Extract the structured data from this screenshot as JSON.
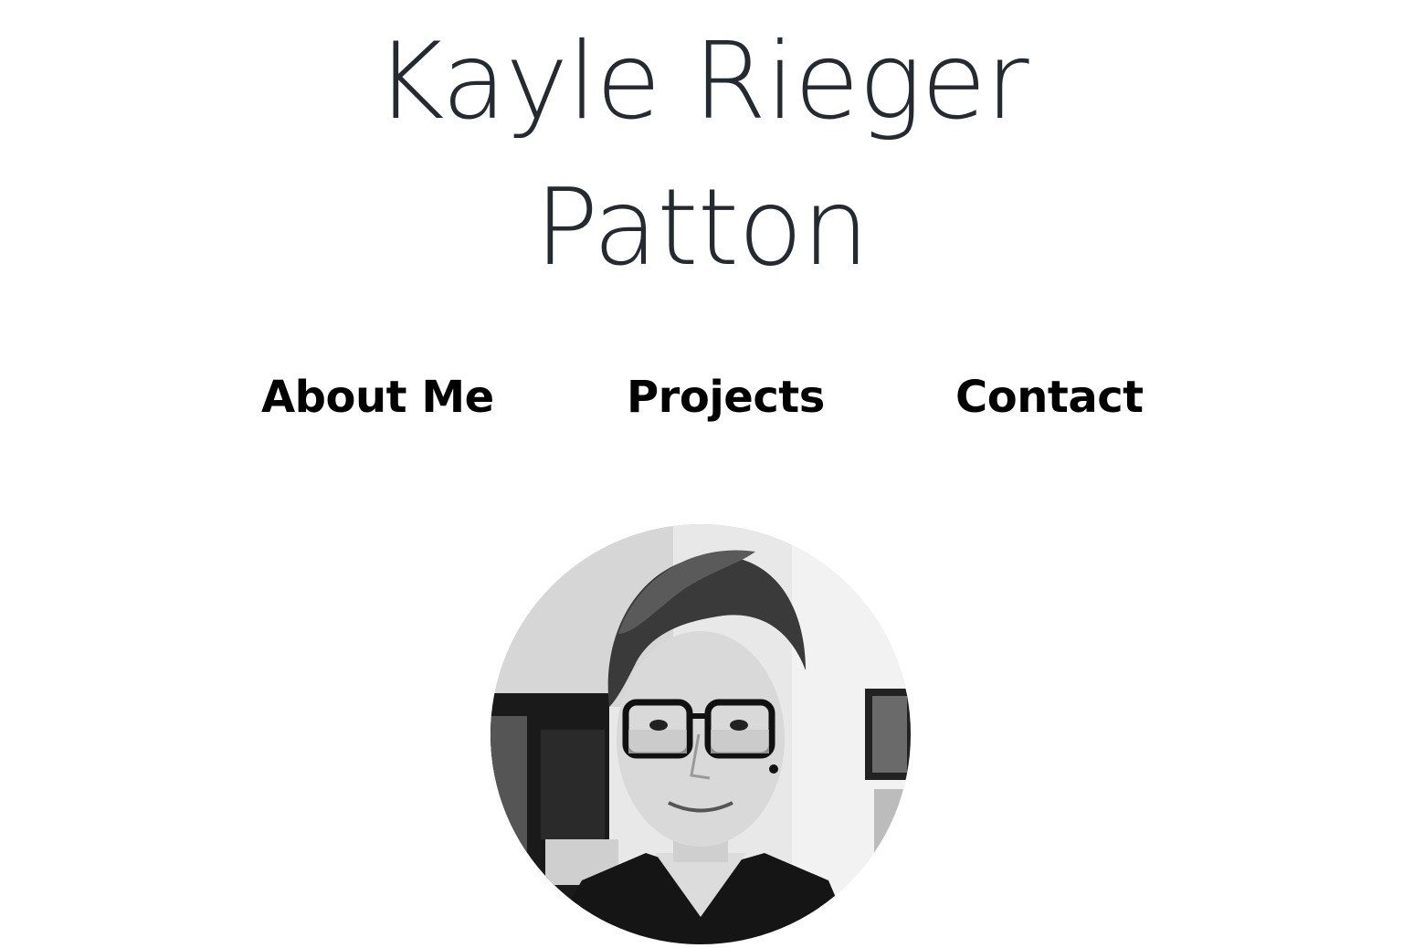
{
  "header": {
    "title_line1": "Kayle Rieger",
    "title_line2": "Patton"
  },
  "nav": {
    "items": [
      {
        "label": "About Me"
      },
      {
        "label": "Projects"
      },
      {
        "label": "Contact"
      }
    ]
  },
  "profile": {
    "photo_icon": "portrait-photo"
  },
  "colors": {
    "title": "#252a31",
    "nav_text": "#000000",
    "background": "#ffffff"
  }
}
